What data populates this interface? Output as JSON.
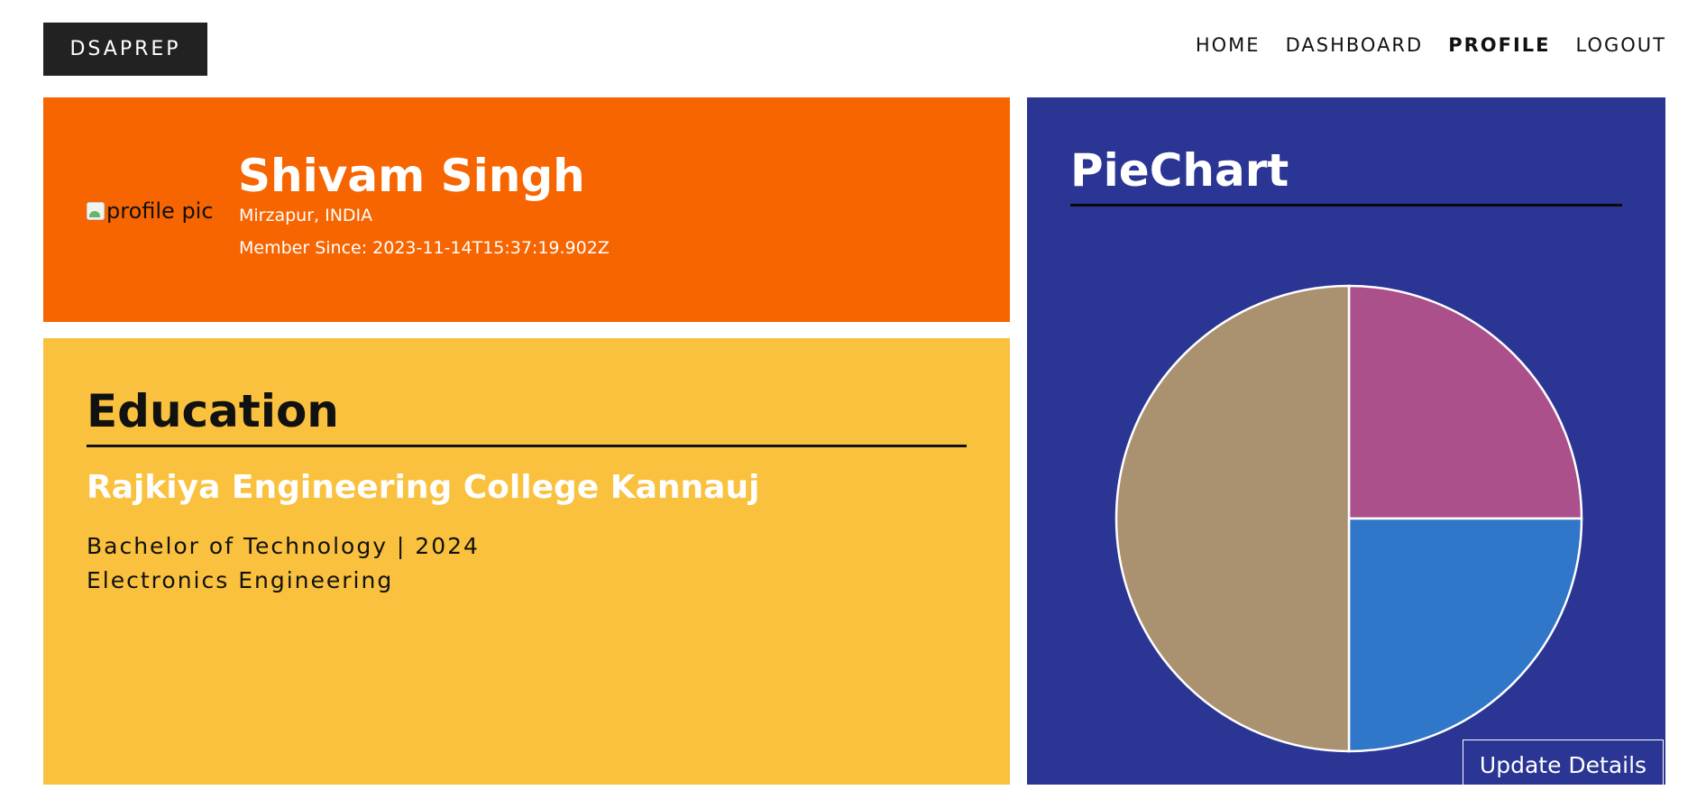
{
  "header": {
    "brand": "DSAPREP",
    "nav": [
      {
        "label": "HOME",
        "active": false
      },
      {
        "label": "DASHBOARD",
        "active": false
      },
      {
        "label": "PROFILE",
        "active": true
      },
      {
        "label": "LOGOUT",
        "active": false
      }
    ]
  },
  "profile": {
    "avatar_alt": "profile pic",
    "name": "Shivam Singh",
    "location": "Mirzapur, INDIA",
    "member_since": "Member Since: 2023-11-14T15:37:19.902Z"
  },
  "education": {
    "title": "Education",
    "college": "Rajkiya Engineering College Kannauj",
    "degree_line": "Bachelor of Technology | 2024",
    "branch": "Electronics Engineering"
  },
  "chart_panel": {
    "title": "PieChart",
    "update_label": "Update Details"
  },
  "colors": {
    "profile_bg": "#f76501",
    "education_bg": "#f9c13d",
    "chart_bg": "#2b3594",
    "brand_bg": "#222222"
  },
  "chart_data": {
    "type": "pie",
    "values": [
      25,
      25,
      50
    ],
    "colors": [
      "#ab508a",
      "#3077c9",
      "#aa9170"
    ],
    "start_angle_deg": 0,
    "direction": "clockwise"
  }
}
